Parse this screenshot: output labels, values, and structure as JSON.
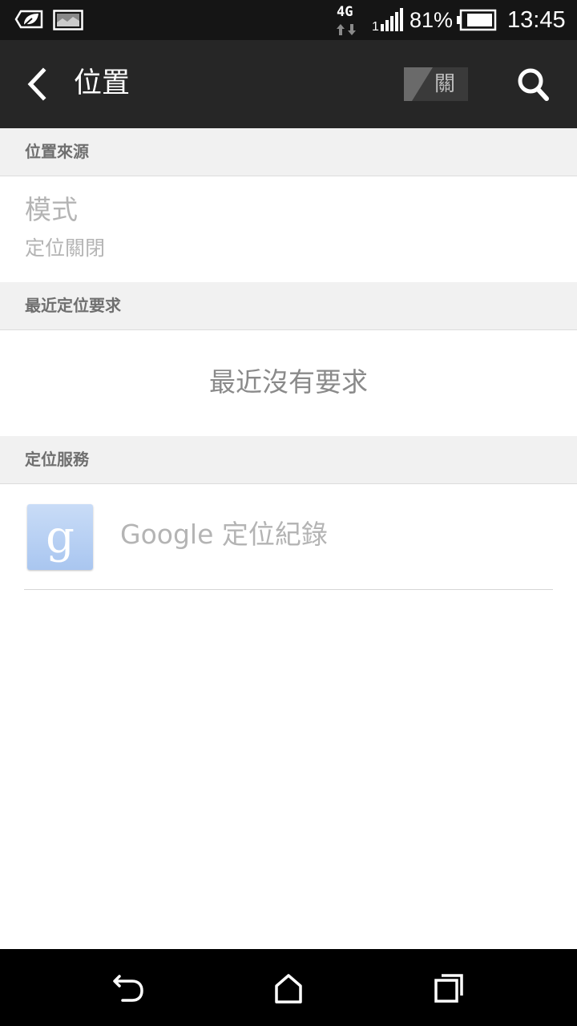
{
  "status_bar": {
    "network": "4G",
    "battery_percent": "81%",
    "time": "13:45",
    "icons": [
      "eco-leaf-icon",
      "screenshot-image-icon",
      "network-4g-icon",
      "signal-strength-icon",
      "battery-icon"
    ]
  },
  "action_bar": {
    "back_icon": "chevron-left-icon",
    "title": "位置",
    "toggle_label": "關",
    "search_icon": "search-icon"
  },
  "sections": {
    "location_source": {
      "header": "位置來源",
      "mode_title": "模式",
      "mode_value": "定位關閉"
    },
    "recent_requests": {
      "header": "最近定位要求",
      "empty_text": "最近沒有要求"
    },
    "location_services": {
      "header": "定位服務",
      "items": [
        {
          "label": "Google 定位紀錄",
          "icon": "google-g-icon"
        }
      ]
    }
  },
  "nav_bar": {
    "icons": [
      "back-arrow-icon",
      "home-icon",
      "recent-apps-icon"
    ]
  },
  "colors": {
    "status_bar_bg": "#151515",
    "action_bar_bg": "#262626",
    "section_header_bg": "#f1f1f1",
    "disabled_text": "#b4b4b4",
    "google_icon_bg": "#b6cff2"
  }
}
